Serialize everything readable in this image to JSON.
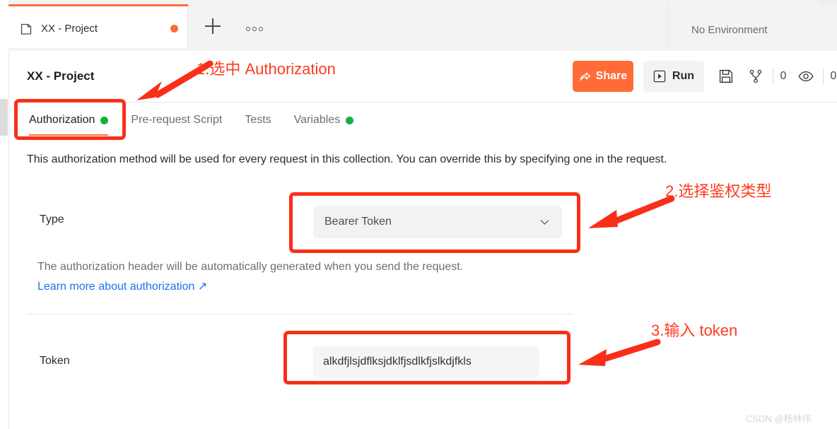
{
  "window": {
    "tab": {
      "icon": "collection-icon",
      "label": "XX - Project",
      "unsaved_dot": true
    },
    "new_tab_label": "+",
    "more_options_label": "•••",
    "environment_selector": "No Environment"
  },
  "collection": {
    "title": "XX - Project",
    "actions": {
      "share_label": "Share",
      "run_label": "Run",
      "save_icon": "save-icon",
      "fork_icon": "fork-icon",
      "fork_count": "0",
      "watch_icon": "eye-icon",
      "watch_count": "0"
    },
    "tabs": [
      {
        "label": "Authorization",
        "active": true,
        "dot": "green"
      },
      {
        "label": "Pre-request Script",
        "active": false,
        "dot": null
      },
      {
        "label": "Tests",
        "active": false,
        "dot": null
      },
      {
        "label": "Variables",
        "active": false,
        "dot": "green"
      }
    ]
  },
  "authorization": {
    "description": "This authorization method will be used for every request in this collection. You can override this by specifying one in the request.",
    "type_label": "Type",
    "type_value": "Bearer Token",
    "hint": "The authorization header will be automatically generated when you send the request.",
    "learn_more": "Learn more about authorization ↗",
    "token_label": "Token",
    "token_value": "alkdfjlsjdflksjdklfjsdlkfjslkdjfkls",
    "token_placeholder": "Token"
  },
  "annotations": {
    "step1": "1.选中 Authorization",
    "step2": "2.选择鉴权类型",
    "step3": "3.输入 token",
    "color": "#fd3b1e"
  },
  "watermark": "CSDN @杨林伟",
  "colors": {
    "accent_orange": "#ff6c37",
    "status_green": "#17af3f",
    "link_blue": "#1a73e8",
    "annotation_red": "#f92f19"
  }
}
